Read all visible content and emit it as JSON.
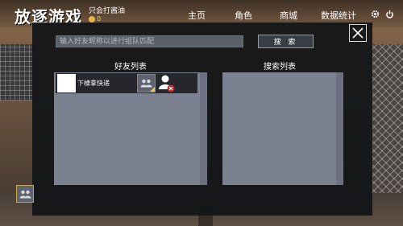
{
  "header": {
    "logo_text": "放逐游戏",
    "username": "只会打酱油",
    "coins": "0",
    "nav": {
      "home": "主页",
      "role": "角色",
      "shop": "商城",
      "stats": "数据统计"
    }
  },
  "icons": {
    "settings": "gear-icon",
    "power": "power-icon",
    "close": "close-icon",
    "team": "team-icon",
    "remove": "remove-friend-icon"
  },
  "search": {
    "placeholder": "输入好友昵称以进行组队匹配",
    "value": "",
    "button_label": "搜 索"
  },
  "friends": {
    "title": "好友列表",
    "items": [
      {
        "name": "下棣拿快递"
      }
    ]
  },
  "results": {
    "title": "搜索列表",
    "items": []
  },
  "colors": {
    "modal_bg": "#121418",
    "panel_bg": "#7c8191",
    "accent_gold": "#e8c44a",
    "remove_red": "#c62828"
  }
}
